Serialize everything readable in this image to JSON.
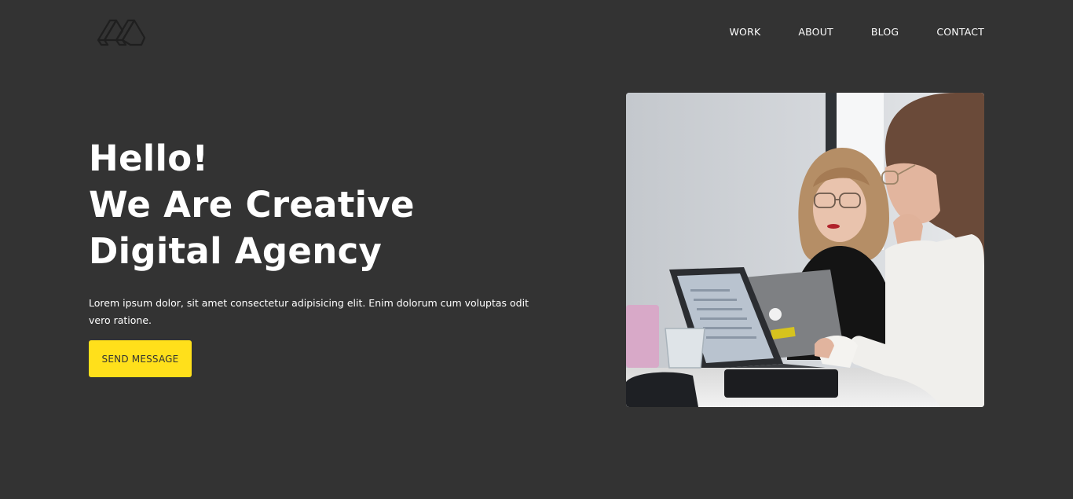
{
  "header": {
    "logo_icon": "agency-logo-icon",
    "nav": [
      {
        "label": "WORK"
      },
      {
        "label": "ABOUT"
      },
      {
        "label": "BLOG"
      },
      {
        "label": "CONTACT"
      }
    ]
  },
  "hero": {
    "title_lines": [
      "Hello!",
      "We Are Creative",
      "Digital Agency"
    ],
    "description": "Lorem ipsum dolor, sit amet consectetur adipisicing elit. Enim dolorum cum voluptas odit vero ratione.",
    "cta_label": "SEND MESSAGE",
    "image_alt": "Two women working on laptops in an office"
  },
  "colors": {
    "background": "#333333",
    "accent": "#ffe01b",
    "text": "#ffffff"
  }
}
